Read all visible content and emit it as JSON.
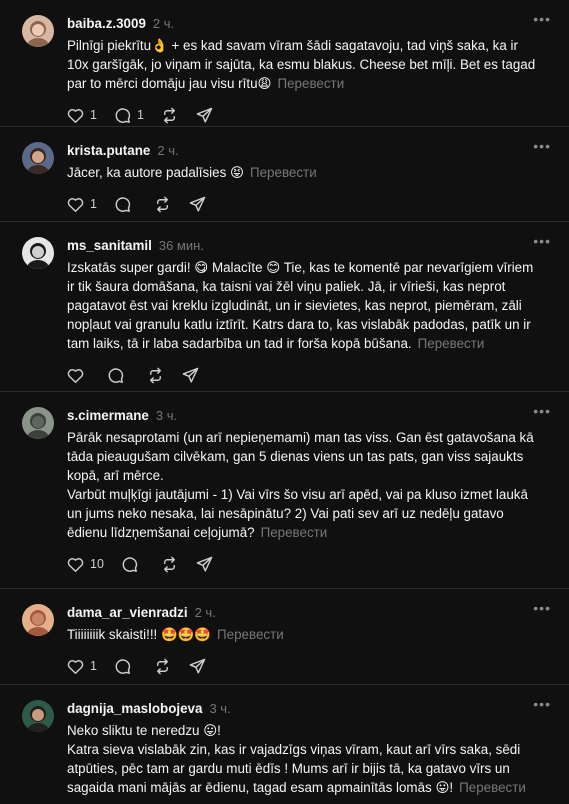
{
  "translate_label": "Перевести",
  "comments": [
    {
      "username": "baiba.z.3009",
      "time": "2 ч.",
      "lines": [
        "Pilnīgi piekrītu👌 + es kad savam vīram šādi sagatavoju, tad viņš saka, ka ir 10x garšīgāk, jo viņam ir sajūta, ka esmu blakus. Cheese bet mīļi. Bet es tagad par to mērci domāju jau visu rītu😩"
      ],
      "likes": "1",
      "replies": "1",
      "avatar": {
        "bg": "#d8b7a0",
        "skin": "#f0c9b4",
        "hair": "#8a6650"
      }
    },
    {
      "username": "krista.putane",
      "time": "2 ч.",
      "lines": [
        "Jācer, ka autore padalīsies 😝"
      ],
      "likes": "1",
      "replies": "",
      "avatar": {
        "bg": "#5a6a8a",
        "skin": "#d7a58a",
        "hair": "#3a2a22"
      }
    },
    {
      "username": "ms_sanitamil",
      "time": "36 мин.",
      "lines": [
        "Izskatās super gardi! 😋 Malacīte 😊 Tie, kas te komentē par nevarīgiem vīriem ir tik šaura domāšana, ka taisni vai žēl viņu paliek. Jā, ir vīrieši, kas neprot pagatavot ēst vai kreklu izgludināt, un ir sievietes, kas neprot, piemēram, zāli nopļaut vai granulu katlu iztīrīt. Katrs dara to, kas vislabāk padodas, patīk un ir tam laiks, tā ir laba sadarbība un tad ir forša kopā būšana."
      ],
      "likes": "",
      "replies": "",
      "avatar": {
        "bg": "#e6e6e6",
        "skin": "#cfcfcf",
        "hair": "#1a1a1a"
      }
    },
    {
      "username": "s.cimermane",
      "time": "3 ч.",
      "lines": [
        "Pārāk nesaprotami (un arī nepieņemami) man tas viss. Gan ēst gatavošana kā tāda pieaugušam cilvēkam, gan 5 dienas viens un tas pats, gan viss sajaukts kopā, arī mērce.",
        "Varbūt muļķīgi jautājumi - 1) Vai vīrs šo visu arī apēd, vai pa kluso izmet laukā un jums neko nesaka, lai nesāpinātu? 2) Vai pati sev arī uz nedēļu gatavo ēdienu līdzņemšanai ceļojumā?"
      ],
      "likes": "10",
      "replies": "",
      "avatar": {
        "bg": "#8a948a",
        "skin": "#5d665e",
        "hair": "#3b423c"
      }
    },
    {
      "username": "dama_ar_vienradzi",
      "time": "2 ч.",
      "lines": [
        "Tiiiiiiiik skaisti!!! 🤩🤩🤩"
      ],
      "likes": "1",
      "replies": "",
      "avatar": {
        "bg": "#e5b089",
        "skin": "#c9856a",
        "hair": "#a45a3e"
      }
    },
    {
      "username": "dagnija_maslobojeva",
      "time": "3 ч.",
      "lines": [
        "Neko sliktu te neredzu 😛!",
        "Katra sieva vislabāk zin, kas ir vajadzīgs viņas vīram, kaut arī vīrs saka, sēdi atpūties, pēc tam ar gardu muti ēdīs ! Mums arī ir bijis tā, ka gatavo vīrs un sagaida mani mājās ar ēdienu, tagad esam apmainītās lomās 😛!"
      ],
      "likes": "",
      "replies": "",
      "avatar": {
        "bg": "#2e5a48",
        "skin": "#c89a7e",
        "hair": "#22201c"
      }
    }
  ]
}
